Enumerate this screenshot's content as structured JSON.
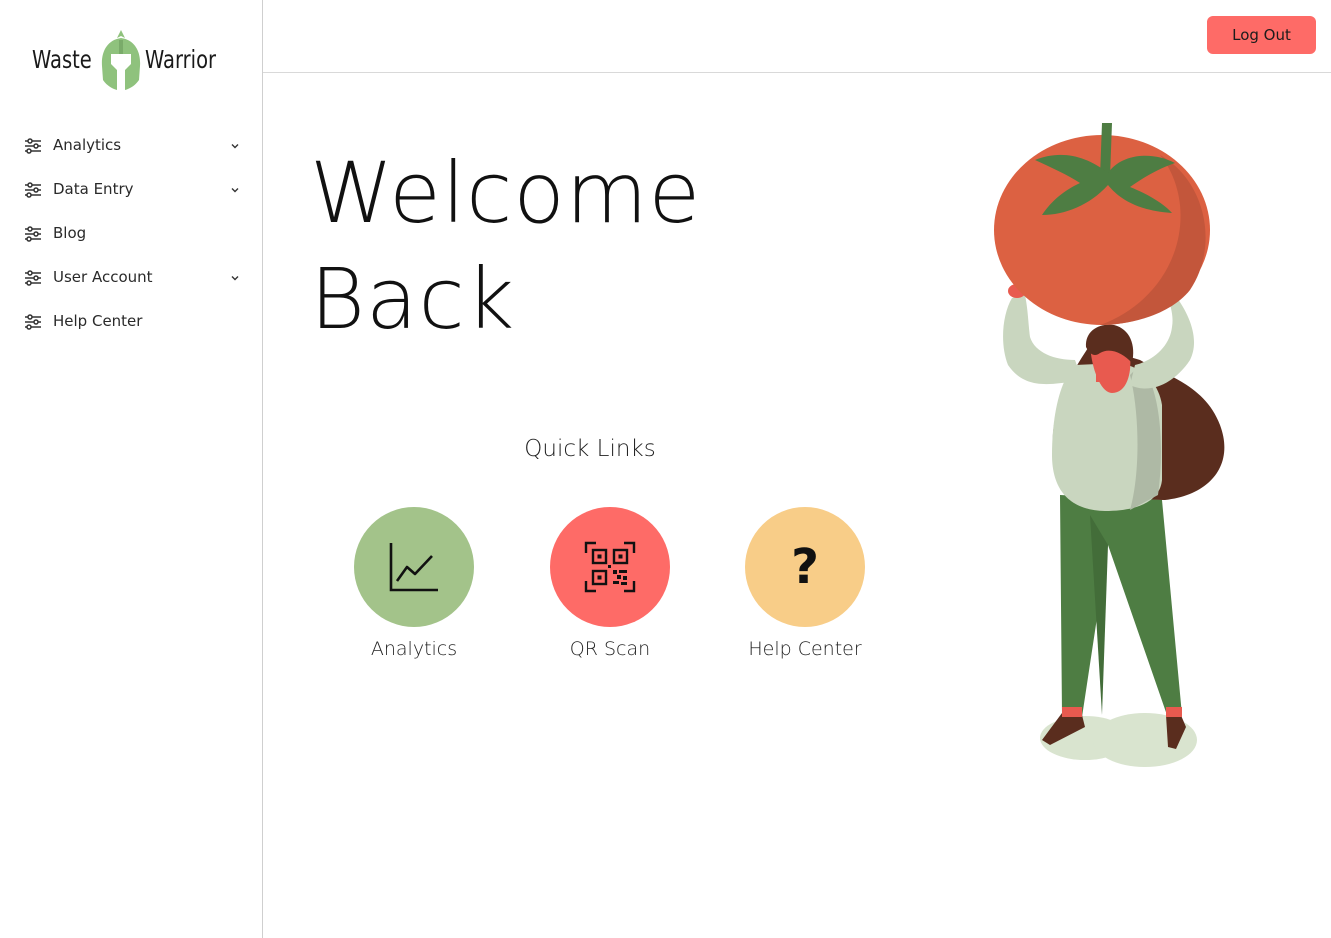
{
  "brand": {
    "name_left": "Waste",
    "name_right": "Warrior",
    "accent_color": "#8fc27d"
  },
  "sidebar": {
    "items": [
      {
        "label": "Analytics",
        "icon": "sliders-icon",
        "has_chevron": true
      },
      {
        "label": "Data Entry",
        "icon": "sliders-icon",
        "has_chevron": true
      },
      {
        "label": "Blog",
        "icon": "sliders-icon",
        "has_chevron": false
      },
      {
        "label": "User Account",
        "icon": "sliders-icon",
        "has_chevron": true
      },
      {
        "label": "Help Center",
        "icon": "sliders-icon",
        "has_chevron": false
      }
    ]
  },
  "header": {
    "logout_label": "Log Out",
    "logout_color": "#fe6b67"
  },
  "main": {
    "welcome_line1": "Welcome",
    "welcome_line2": "Back",
    "quick_links_title": "Quick Links",
    "quick_links": [
      {
        "label": "Analytics",
        "icon": "line-chart-icon",
        "color": "#a3c38a"
      },
      {
        "label": "QR Scan",
        "icon": "qr-code-icon",
        "color": "#fe6b67"
      },
      {
        "label": "Help Center",
        "icon": "question-mark-icon",
        "color": "#f8cd88"
      }
    ],
    "help_glyph": "?"
  },
  "illustration": {
    "subject": "woman-carrying-tomato-illustration"
  }
}
